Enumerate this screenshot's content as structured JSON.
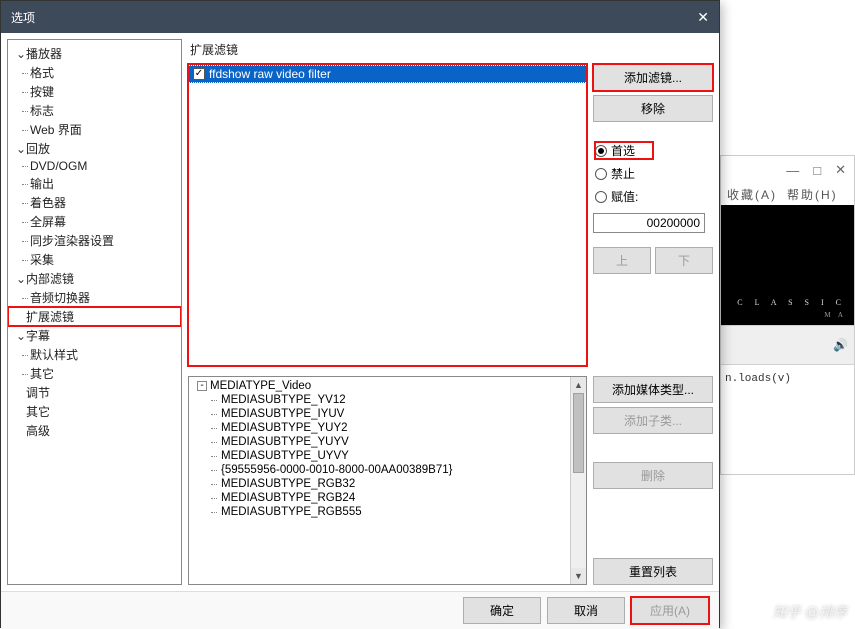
{
  "bgwin": {
    "controls": {
      "min": "—",
      "max": "□",
      "close": "✕"
    },
    "menu": {
      "fav": "收藏(A)",
      "help": "帮助(H)"
    },
    "logo": "C L A S S I C",
    "logo_sub": "M  A",
    "code": "n.loads(v)"
  },
  "dialog": {
    "title": "选项",
    "close": "✕",
    "tree": {
      "player": {
        "label": "播放器",
        "children": [
          "格式",
          "按键",
          "标志",
          "Web 界面"
        ]
      },
      "playback": {
        "label": "回放",
        "children": [
          "DVD/OGM",
          "输出",
          "着色器",
          "全屏幕",
          "同步渲染器设置",
          "采集"
        ]
      },
      "internal": {
        "label": "内部滤镜",
        "children": [
          "音频切换器"
        ]
      },
      "ext": {
        "label": "扩展滤镜"
      },
      "subs": {
        "label": "字幕",
        "children": [
          "默认样式",
          "其它"
        ]
      },
      "misc": [
        "调节",
        "其它",
        "高级"
      ]
    },
    "panel": {
      "title": "扩展滤镜",
      "filters": [
        {
          "checked": true,
          "label": "ffdshow raw video filter",
          "selected": true
        }
      ],
      "buttons": {
        "add_filter": "添加滤镜...",
        "remove": "移除",
        "up": "上",
        "down": "下"
      },
      "radios": {
        "prefer": "首选",
        "block": "禁止",
        "merit": "赋值:"
      },
      "merit_value": "00200000",
      "mediatree": {
        "root": "MEDIATYPE_Video",
        "items": [
          "MEDIASUBTYPE_YV12",
          "MEDIASUBTYPE_IYUV",
          "MEDIASUBTYPE_YUY2",
          "MEDIASUBTYPE_YUYV",
          "MEDIASUBTYPE_UYVY",
          "{59555956-0000-0010-8000-00AA00389B71}",
          "MEDIASUBTYPE_RGB32",
          "MEDIASUBTYPE_RGB24",
          "MEDIASUBTYPE_RGB555"
        ]
      },
      "buttons2": {
        "add_media": "添加媒体类型...",
        "add_sub": "添加子类...",
        "delete": "删除",
        "reset": "重置列表"
      }
    },
    "footer": {
      "ok": "确定",
      "cancel": "取消",
      "apply": "应用(A)"
    }
  },
  "watermark": "知乎 @排序"
}
